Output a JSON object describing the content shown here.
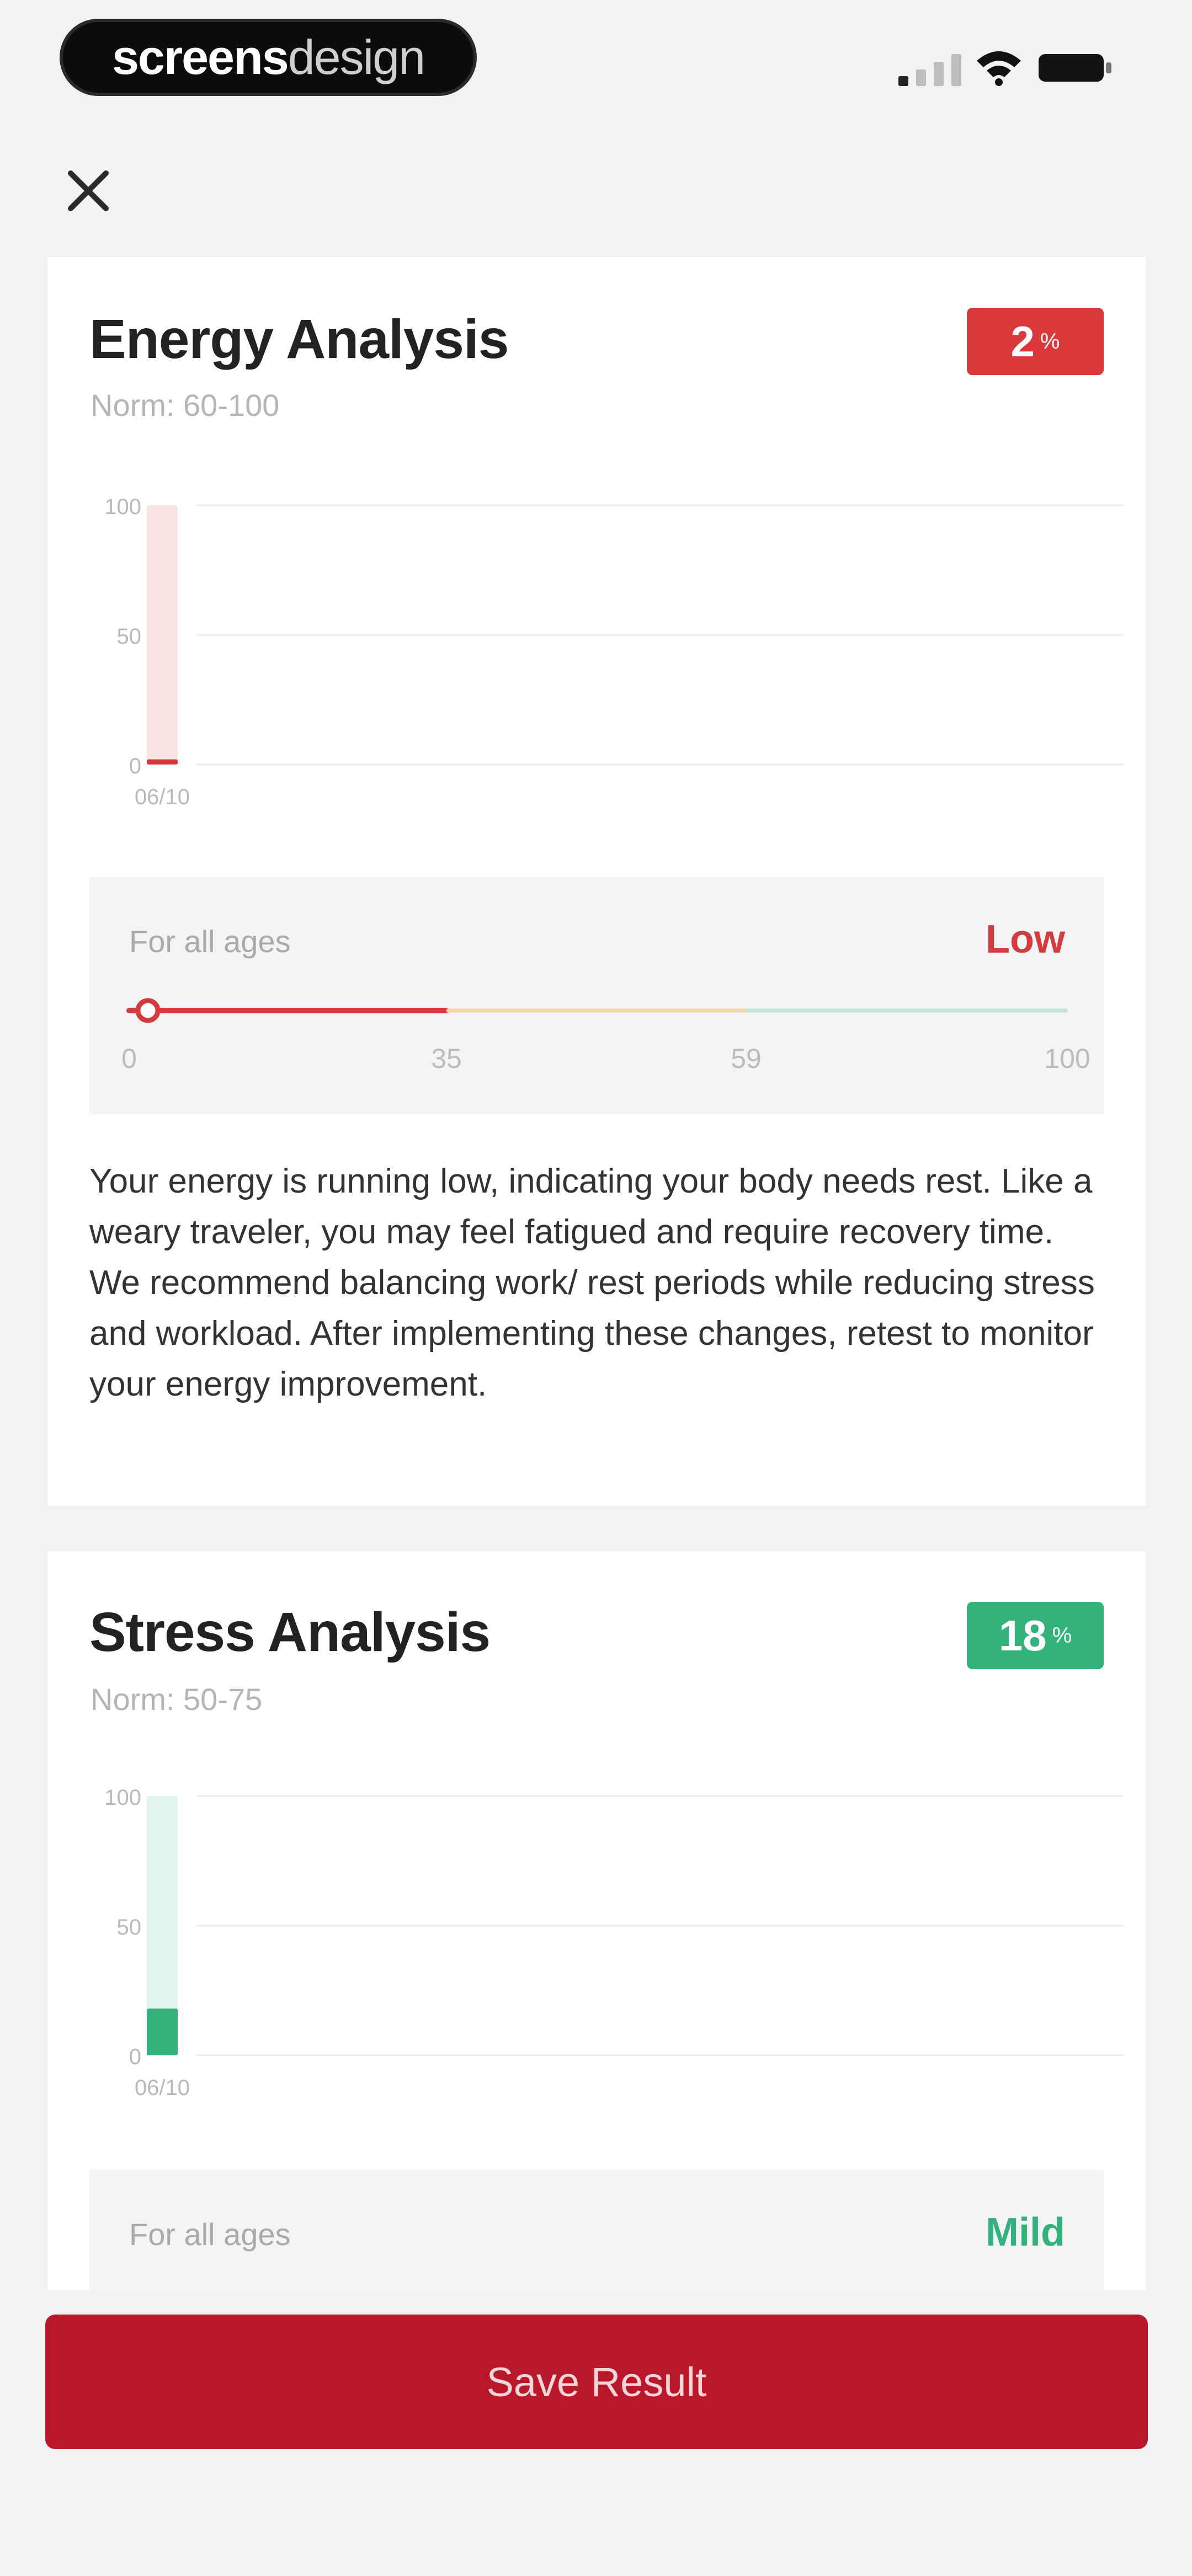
{
  "status_bar": {
    "brand_bold": "screens",
    "brand_light": "design",
    "icons": [
      "signal-icon",
      "wifi-icon",
      "battery-icon"
    ]
  },
  "toolbar": {
    "close_icon": "close-icon"
  },
  "energy": {
    "title": "Energy Analysis",
    "norm": "Norm: 60-100",
    "badge_value": "2",
    "badge_unit": "%",
    "badge_color": "#d9393b",
    "range": {
      "caption": "For all ages",
      "level": "Low",
      "level_color": "#d33b3d",
      "ticks": [
        "0",
        "35",
        "59",
        "100"
      ],
      "value": 2
    },
    "description": "Your energy is running low, indicating your body needs rest. Like a weary traveler, you may feel fatigued and require recovery time. We recommend balancing work/ rest periods while reducing stress and workload. After implementing these changes, retest to monitor your energy improvement."
  },
  "stress": {
    "title": "Stress Analysis",
    "norm": "Norm: 50-75",
    "badge_value": "18",
    "badge_unit": "%",
    "badge_color": "#34b27b",
    "range": {
      "caption": "For all ages",
      "level": "Mild",
      "level_color": "#34b27b"
    }
  },
  "chart_data": [
    {
      "type": "bar",
      "categories": [
        "06/10"
      ],
      "values": [
        2
      ],
      "ylim": [
        0,
        100
      ],
      "yticks": [
        "100",
        "50",
        "0"
      ],
      "grid": true,
      "color": "#d9393b"
    },
    {
      "type": "bar",
      "categories": [
        "06/10"
      ],
      "values": [
        18
      ],
      "ylim": [
        0,
        100
      ],
      "yticks": [
        "100",
        "50",
        "0"
      ],
      "grid": true,
      "color": "#34b27b"
    }
  ],
  "actions": {
    "save_label": "Save Result"
  }
}
